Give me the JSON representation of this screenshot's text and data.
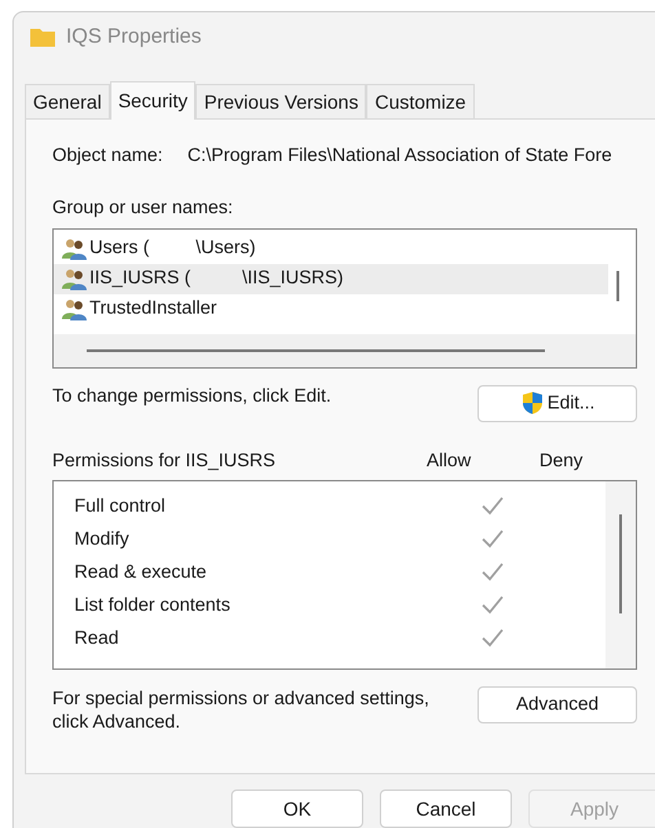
{
  "window": {
    "title": "IQS Properties"
  },
  "tabs": [
    {
      "label": "General",
      "selected": false
    },
    {
      "label": "Security",
      "selected": true
    },
    {
      "label": "Previous Versions",
      "selected": false
    },
    {
      "label": "Customize",
      "selected": false
    }
  ],
  "object_name": {
    "label": "Object name:",
    "value": "C:\\Program Files\\National Association of State Fore"
  },
  "groups": {
    "label": "Group or user names:",
    "items": [
      {
        "name": "Users (         \\Users)",
        "selected": false
      },
      {
        "name": "IIS_IUSRS (          \\IIS_IUSRS)",
        "selected": true
      },
      {
        "name": "TrustedInstaller",
        "selected": false
      }
    ]
  },
  "change_hint": "To change permissions, click Edit.",
  "edit_button": "Edit...",
  "permissions": {
    "title": "Permissions for IIS_IUSRS",
    "allow_header": "Allow",
    "deny_header": "Deny",
    "rows": [
      {
        "name": "Full control",
        "allow": true,
        "deny": false
      },
      {
        "name": "Modify",
        "allow": true,
        "deny": false
      },
      {
        "name": "Read & execute",
        "allow": true,
        "deny": false
      },
      {
        "name": "List folder contents",
        "allow": true,
        "deny": false
      },
      {
        "name": "Read",
        "allow": true,
        "deny": false
      }
    ]
  },
  "advanced_hint": "For special permissions or advanced settings, click Advanced.",
  "advanced_button": "Advanced",
  "buttons": [
    {
      "label": "OK",
      "disabled": false
    },
    {
      "label": "Cancel",
      "disabled": false
    },
    {
      "label": "Apply",
      "disabled": true
    }
  ]
}
